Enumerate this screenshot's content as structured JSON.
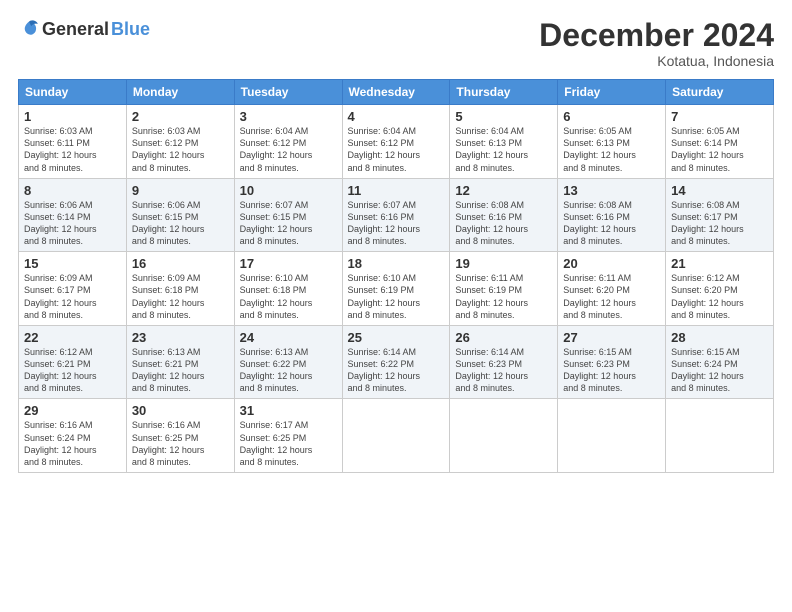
{
  "logo": {
    "general": "General",
    "blue": "Blue"
  },
  "title": "December 2024",
  "location": "Kotatua, Indonesia",
  "days_header": [
    "Sunday",
    "Monday",
    "Tuesday",
    "Wednesday",
    "Thursday",
    "Friday",
    "Saturday"
  ],
  "weeks": [
    [
      {
        "day": "1",
        "info": "Sunrise: 6:03 AM\nSunset: 6:11 PM\nDaylight: 12 hours\nand 8 minutes."
      },
      {
        "day": "2",
        "info": "Sunrise: 6:03 AM\nSunset: 6:12 PM\nDaylight: 12 hours\nand 8 minutes."
      },
      {
        "day": "3",
        "info": "Sunrise: 6:04 AM\nSunset: 6:12 PM\nDaylight: 12 hours\nand 8 minutes."
      },
      {
        "day": "4",
        "info": "Sunrise: 6:04 AM\nSunset: 6:12 PM\nDaylight: 12 hours\nand 8 minutes."
      },
      {
        "day": "5",
        "info": "Sunrise: 6:04 AM\nSunset: 6:13 PM\nDaylight: 12 hours\nand 8 minutes."
      },
      {
        "day": "6",
        "info": "Sunrise: 6:05 AM\nSunset: 6:13 PM\nDaylight: 12 hours\nand 8 minutes."
      },
      {
        "day": "7",
        "info": "Sunrise: 6:05 AM\nSunset: 6:14 PM\nDaylight: 12 hours\nand 8 minutes."
      }
    ],
    [
      {
        "day": "8",
        "info": "Sunrise: 6:06 AM\nSunset: 6:14 PM\nDaylight: 12 hours\nand 8 minutes."
      },
      {
        "day": "9",
        "info": "Sunrise: 6:06 AM\nSunset: 6:15 PM\nDaylight: 12 hours\nand 8 minutes."
      },
      {
        "day": "10",
        "info": "Sunrise: 6:07 AM\nSunset: 6:15 PM\nDaylight: 12 hours\nand 8 minutes."
      },
      {
        "day": "11",
        "info": "Sunrise: 6:07 AM\nSunset: 6:16 PM\nDaylight: 12 hours\nand 8 minutes."
      },
      {
        "day": "12",
        "info": "Sunrise: 6:08 AM\nSunset: 6:16 PM\nDaylight: 12 hours\nand 8 minutes."
      },
      {
        "day": "13",
        "info": "Sunrise: 6:08 AM\nSunset: 6:16 PM\nDaylight: 12 hours\nand 8 minutes."
      },
      {
        "day": "14",
        "info": "Sunrise: 6:08 AM\nSunset: 6:17 PM\nDaylight: 12 hours\nand 8 minutes."
      }
    ],
    [
      {
        "day": "15",
        "info": "Sunrise: 6:09 AM\nSunset: 6:17 PM\nDaylight: 12 hours\nand 8 minutes."
      },
      {
        "day": "16",
        "info": "Sunrise: 6:09 AM\nSunset: 6:18 PM\nDaylight: 12 hours\nand 8 minutes."
      },
      {
        "day": "17",
        "info": "Sunrise: 6:10 AM\nSunset: 6:18 PM\nDaylight: 12 hours\nand 8 minutes."
      },
      {
        "day": "18",
        "info": "Sunrise: 6:10 AM\nSunset: 6:19 PM\nDaylight: 12 hours\nand 8 minutes."
      },
      {
        "day": "19",
        "info": "Sunrise: 6:11 AM\nSunset: 6:19 PM\nDaylight: 12 hours\nand 8 minutes."
      },
      {
        "day": "20",
        "info": "Sunrise: 6:11 AM\nSunset: 6:20 PM\nDaylight: 12 hours\nand 8 minutes."
      },
      {
        "day": "21",
        "info": "Sunrise: 6:12 AM\nSunset: 6:20 PM\nDaylight: 12 hours\nand 8 minutes."
      }
    ],
    [
      {
        "day": "22",
        "info": "Sunrise: 6:12 AM\nSunset: 6:21 PM\nDaylight: 12 hours\nand 8 minutes."
      },
      {
        "day": "23",
        "info": "Sunrise: 6:13 AM\nSunset: 6:21 PM\nDaylight: 12 hours\nand 8 minutes."
      },
      {
        "day": "24",
        "info": "Sunrise: 6:13 AM\nSunset: 6:22 PM\nDaylight: 12 hours\nand 8 minutes."
      },
      {
        "day": "25",
        "info": "Sunrise: 6:14 AM\nSunset: 6:22 PM\nDaylight: 12 hours\nand 8 minutes."
      },
      {
        "day": "26",
        "info": "Sunrise: 6:14 AM\nSunset: 6:23 PM\nDaylight: 12 hours\nand 8 minutes."
      },
      {
        "day": "27",
        "info": "Sunrise: 6:15 AM\nSunset: 6:23 PM\nDaylight: 12 hours\nand 8 minutes."
      },
      {
        "day": "28",
        "info": "Sunrise: 6:15 AM\nSunset: 6:24 PM\nDaylight: 12 hours\nand 8 minutes."
      }
    ],
    [
      {
        "day": "29",
        "info": "Sunrise: 6:16 AM\nSunset: 6:24 PM\nDaylight: 12 hours\nand 8 minutes."
      },
      {
        "day": "30",
        "info": "Sunrise: 6:16 AM\nSunset: 6:25 PM\nDaylight: 12 hours\nand 8 minutes."
      },
      {
        "day": "31",
        "info": "Sunrise: 6:17 AM\nSunset: 6:25 PM\nDaylight: 12 hours\nand 8 minutes."
      },
      null,
      null,
      null,
      null
    ]
  ]
}
